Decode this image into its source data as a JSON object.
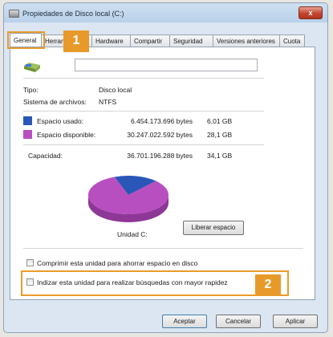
{
  "window": {
    "title": "Propiedades de Disco local (C:)",
    "close_label": "x"
  },
  "tabs": [
    {
      "label": "General",
      "active": true
    },
    {
      "label": "Herramientas",
      "active": false
    },
    {
      "label": "Hardware",
      "active": false
    },
    {
      "label": "Compartir",
      "active": false
    },
    {
      "label": "Seguridad",
      "active": false
    },
    {
      "label": "Versiones anteriores",
      "active": false
    },
    {
      "label": "Cuota",
      "active": false
    }
  ],
  "general": {
    "name_value": "",
    "type_label": "Tipo:",
    "type_value": "Disco local",
    "fs_label": "Sistema de archivos:",
    "fs_value": "NTFS",
    "used_label": "Espacio usado:",
    "used_bytes": "6.454.173.696 bytes",
    "used_gb": "6,01 GB",
    "free_label": "Espacio disponible:",
    "free_bytes": "30.247.022.592 bytes",
    "free_gb": "28,1 GB",
    "capacity_label": "Capacidad:",
    "capacity_bytes": "36.701.196.288 bytes",
    "capacity_gb": "34,1 GB",
    "drive_label": "Unidad C:",
    "free_space_button": "Liberar espacio",
    "compress_label": "Comprimir esta unidad para ahorrar espacio en disco",
    "index_label": "Indizar esta unidad para realizar búsquedas con mayor rapidez",
    "used_fraction": 0.176,
    "colors": {
      "used": "#2a56b8",
      "free": "#b84fc0"
    }
  },
  "footer": {
    "ok": "Aceptar",
    "cancel": "Cancelar",
    "apply": "Aplicar"
  },
  "annotations": {
    "badge1": "1",
    "badge2": "2",
    "color": "#e79a2a"
  }
}
